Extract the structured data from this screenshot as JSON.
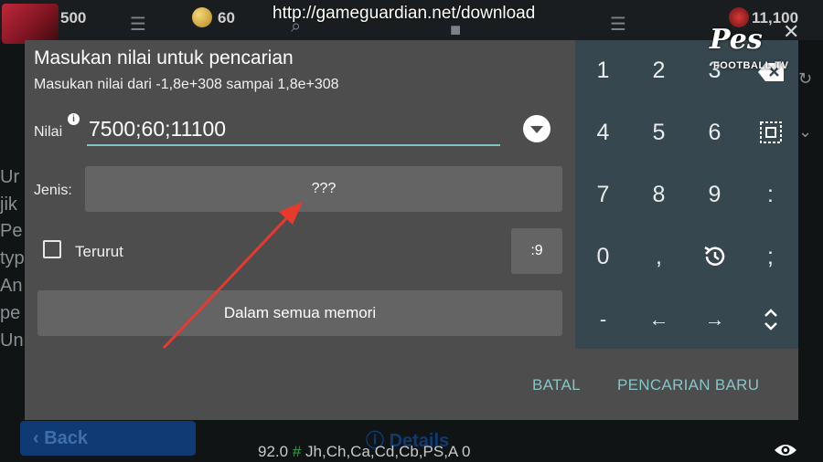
{
  "background": {
    "stats": [
      "500",
      "60",
      "11,100"
    ],
    "left_text": [
      "Ur",
      "jik",
      "Pe",
      "typ",
      "An",
      "pe",
      "Un"
    ],
    "back_label": "Back",
    "details_label": "Details",
    "bottom_value": "92.0",
    "bottom_hash": "#",
    "bottom_tags": "Jh,Ch,Ca,Cd,Cb,PS,A 0"
  },
  "overlay": {
    "url": "http://gameguardian.net/download"
  },
  "dialog": {
    "title": "Masukan nilai untuk pencarian",
    "subtitle": "Masukan nilai dari -1,8e+308 sampai 1,8e+308",
    "value_label": "Nilai",
    "value": "7500;60;11100",
    "type_label": "Jenis:",
    "type_value": "???",
    "ordered_label": "Terurut",
    "ordered_checked": false,
    "range_value": ":9",
    "memory_label": "Dalam semua memori",
    "cancel": "BATAL",
    "new_search": "PENCARIAN BARU",
    "accent_color": "#85c5c7"
  },
  "keypad": {
    "rows": [
      [
        "1",
        "2",
        "3",
        "backspace-icon"
      ],
      [
        "4",
        "5",
        "6",
        "select-all-icon"
      ],
      [
        "7",
        "8",
        "9",
        ":"
      ],
      [
        "0",
        ",",
        "history-icon",
        ";"
      ],
      [
        "-",
        "←",
        "→",
        "expand-icon"
      ]
    ]
  },
  "watermark": {
    "logo": "Pes",
    "site": "FOOTBALL.TV"
  }
}
